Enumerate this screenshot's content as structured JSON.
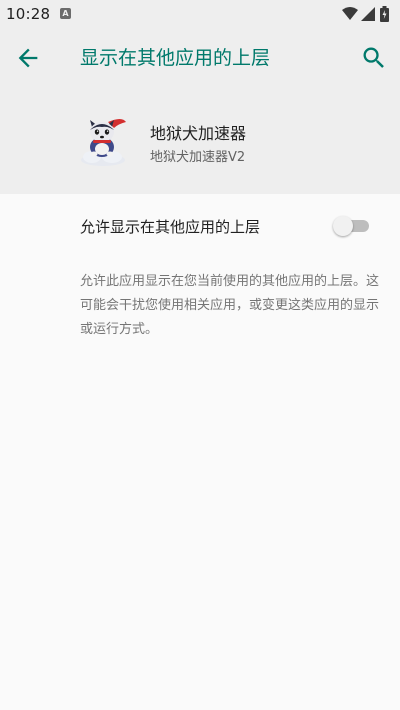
{
  "status_bar": {
    "time": "10:28",
    "notification_icon": "A",
    "icons": [
      "wifi-icon",
      "signal-icon",
      "battery-icon"
    ]
  },
  "app_bar": {
    "title": "显示在其他应用的上层",
    "back_icon": "arrow-left-icon",
    "search_icon": "search-icon",
    "accent_color": "#00796b"
  },
  "app_header": {
    "name": "地狱犬加速器",
    "version": "地狱犬加速器V2",
    "icon": "cerberus-mascot-icon"
  },
  "setting": {
    "label": "允许显示在其他应用的上层",
    "enabled": false
  },
  "description": "允许此应用显示在您当前使用的其他应用的上层。这可能会干扰您使用相关应用，或变更这类应用的显示或运行方式。"
}
